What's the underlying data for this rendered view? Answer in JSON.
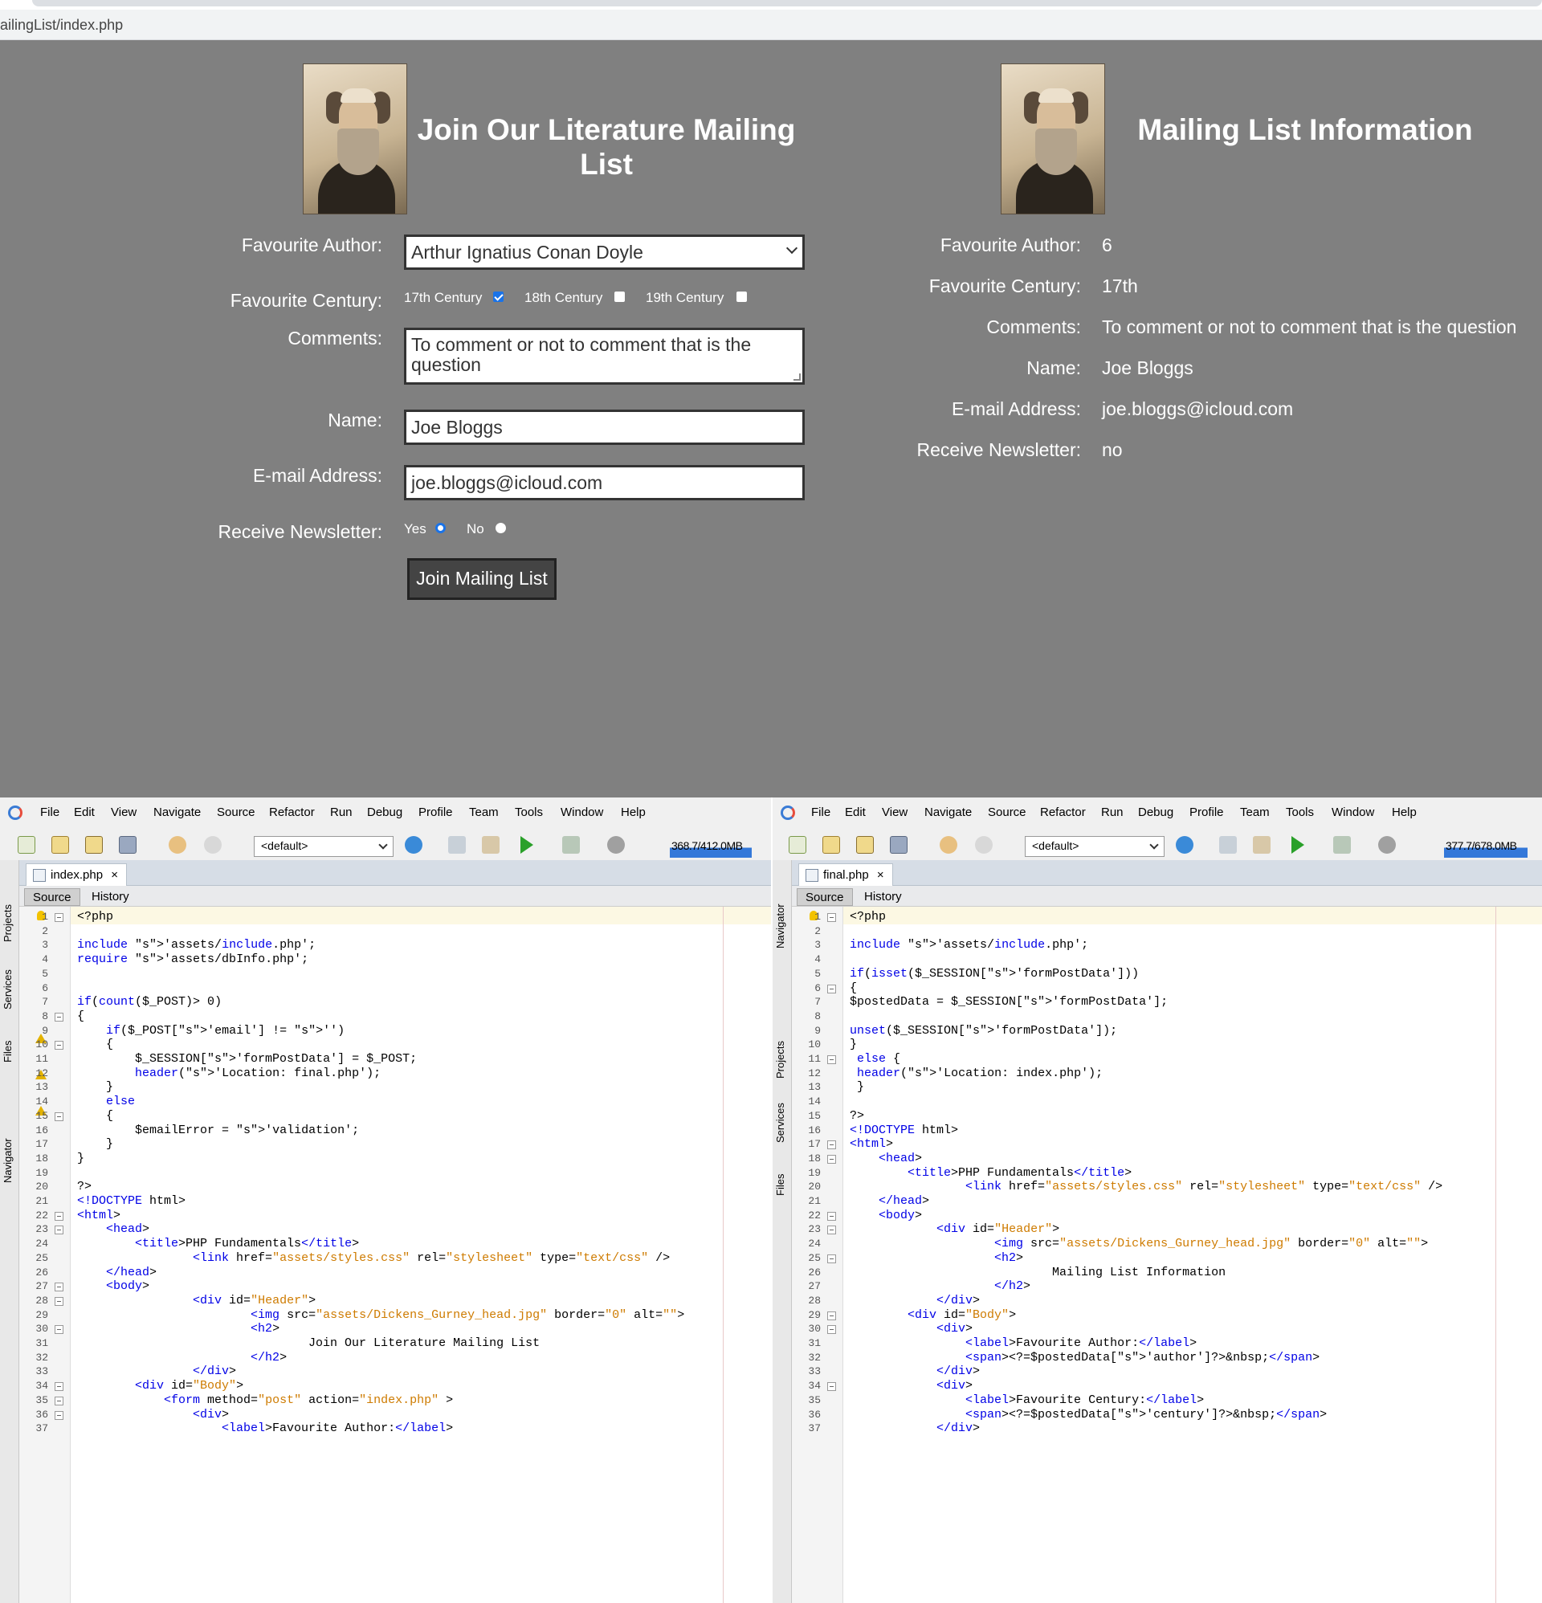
{
  "browser": {
    "url": "ailingList/index.php"
  },
  "form_page": {
    "heading": "Join Our Literature Mailing List",
    "labels": {
      "author": "Favourite Author:",
      "century": "Favourite Century:",
      "comments": "Comments:",
      "name": "Name:",
      "email": "E-mail Address:",
      "newsletter": "Receive Newsletter:"
    },
    "author_value": "Arthur Ignatius Conan Doyle",
    "centuries": [
      {
        "label": "17th Century",
        "checked": true
      },
      {
        "label": "18th Century",
        "checked": false
      },
      {
        "label": "19th Century",
        "checked": false
      }
    ],
    "comments_value": "To comment or not to comment that is the question",
    "name_value": "Joe Bloggs",
    "email_value": "joe.bloggs@icloud.com",
    "newsletter_options": [
      {
        "label": "Yes",
        "selected": true
      },
      {
        "label": "No",
        "selected": false
      }
    ],
    "submit_label": "Join Mailing List"
  },
  "info_page": {
    "heading": "Mailing List Information",
    "rows": [
      {
        "label": "Favourite Author:",
        "value": "6"
      },
      {
        "label": "Favourite Century:",
        "value": "17th"
      },
      {
        "label": "Comments:",
        "value": "To comment or not to comment that is the question"
      },
      {
        "label": "Name:",
        "value": "Joe Bloggs"
      },
      {
        "label": "E-mail Address:",
        "value": "joe.bloggs@icloud.com"
      },
      {
        "label": "Receive Newsletter:",
        "value": "no"
      }
    ]
  },
  "ide": {
    "menu": [
      "File",
      "Edit",
      "View",
      "Navigate",
      "Source",
      "Refactor",
      "Run",
      "Debug",
      "Profile",
      "Team",
      "Tools",
      "Window",
      "Help"
    ],
    "config": "<default>",
    "left": {
      "memory": "368.7/412.0MB",
      "file_tab": "index.php",
      "side_tabs": [
        "Projects",
        "Services",
        "Files",
        "Navigator"
      ]
    },
    "right": {
      "memory": "377.7/678.0MB",
      "file_tab": "final.php",
      "side_tabs": [
        "Navigator",
        "Projects",
        "Services",
        "Files"
      ]
    },
    "subtabs": [
      "Source",
      "History"
    ]
  }
}
